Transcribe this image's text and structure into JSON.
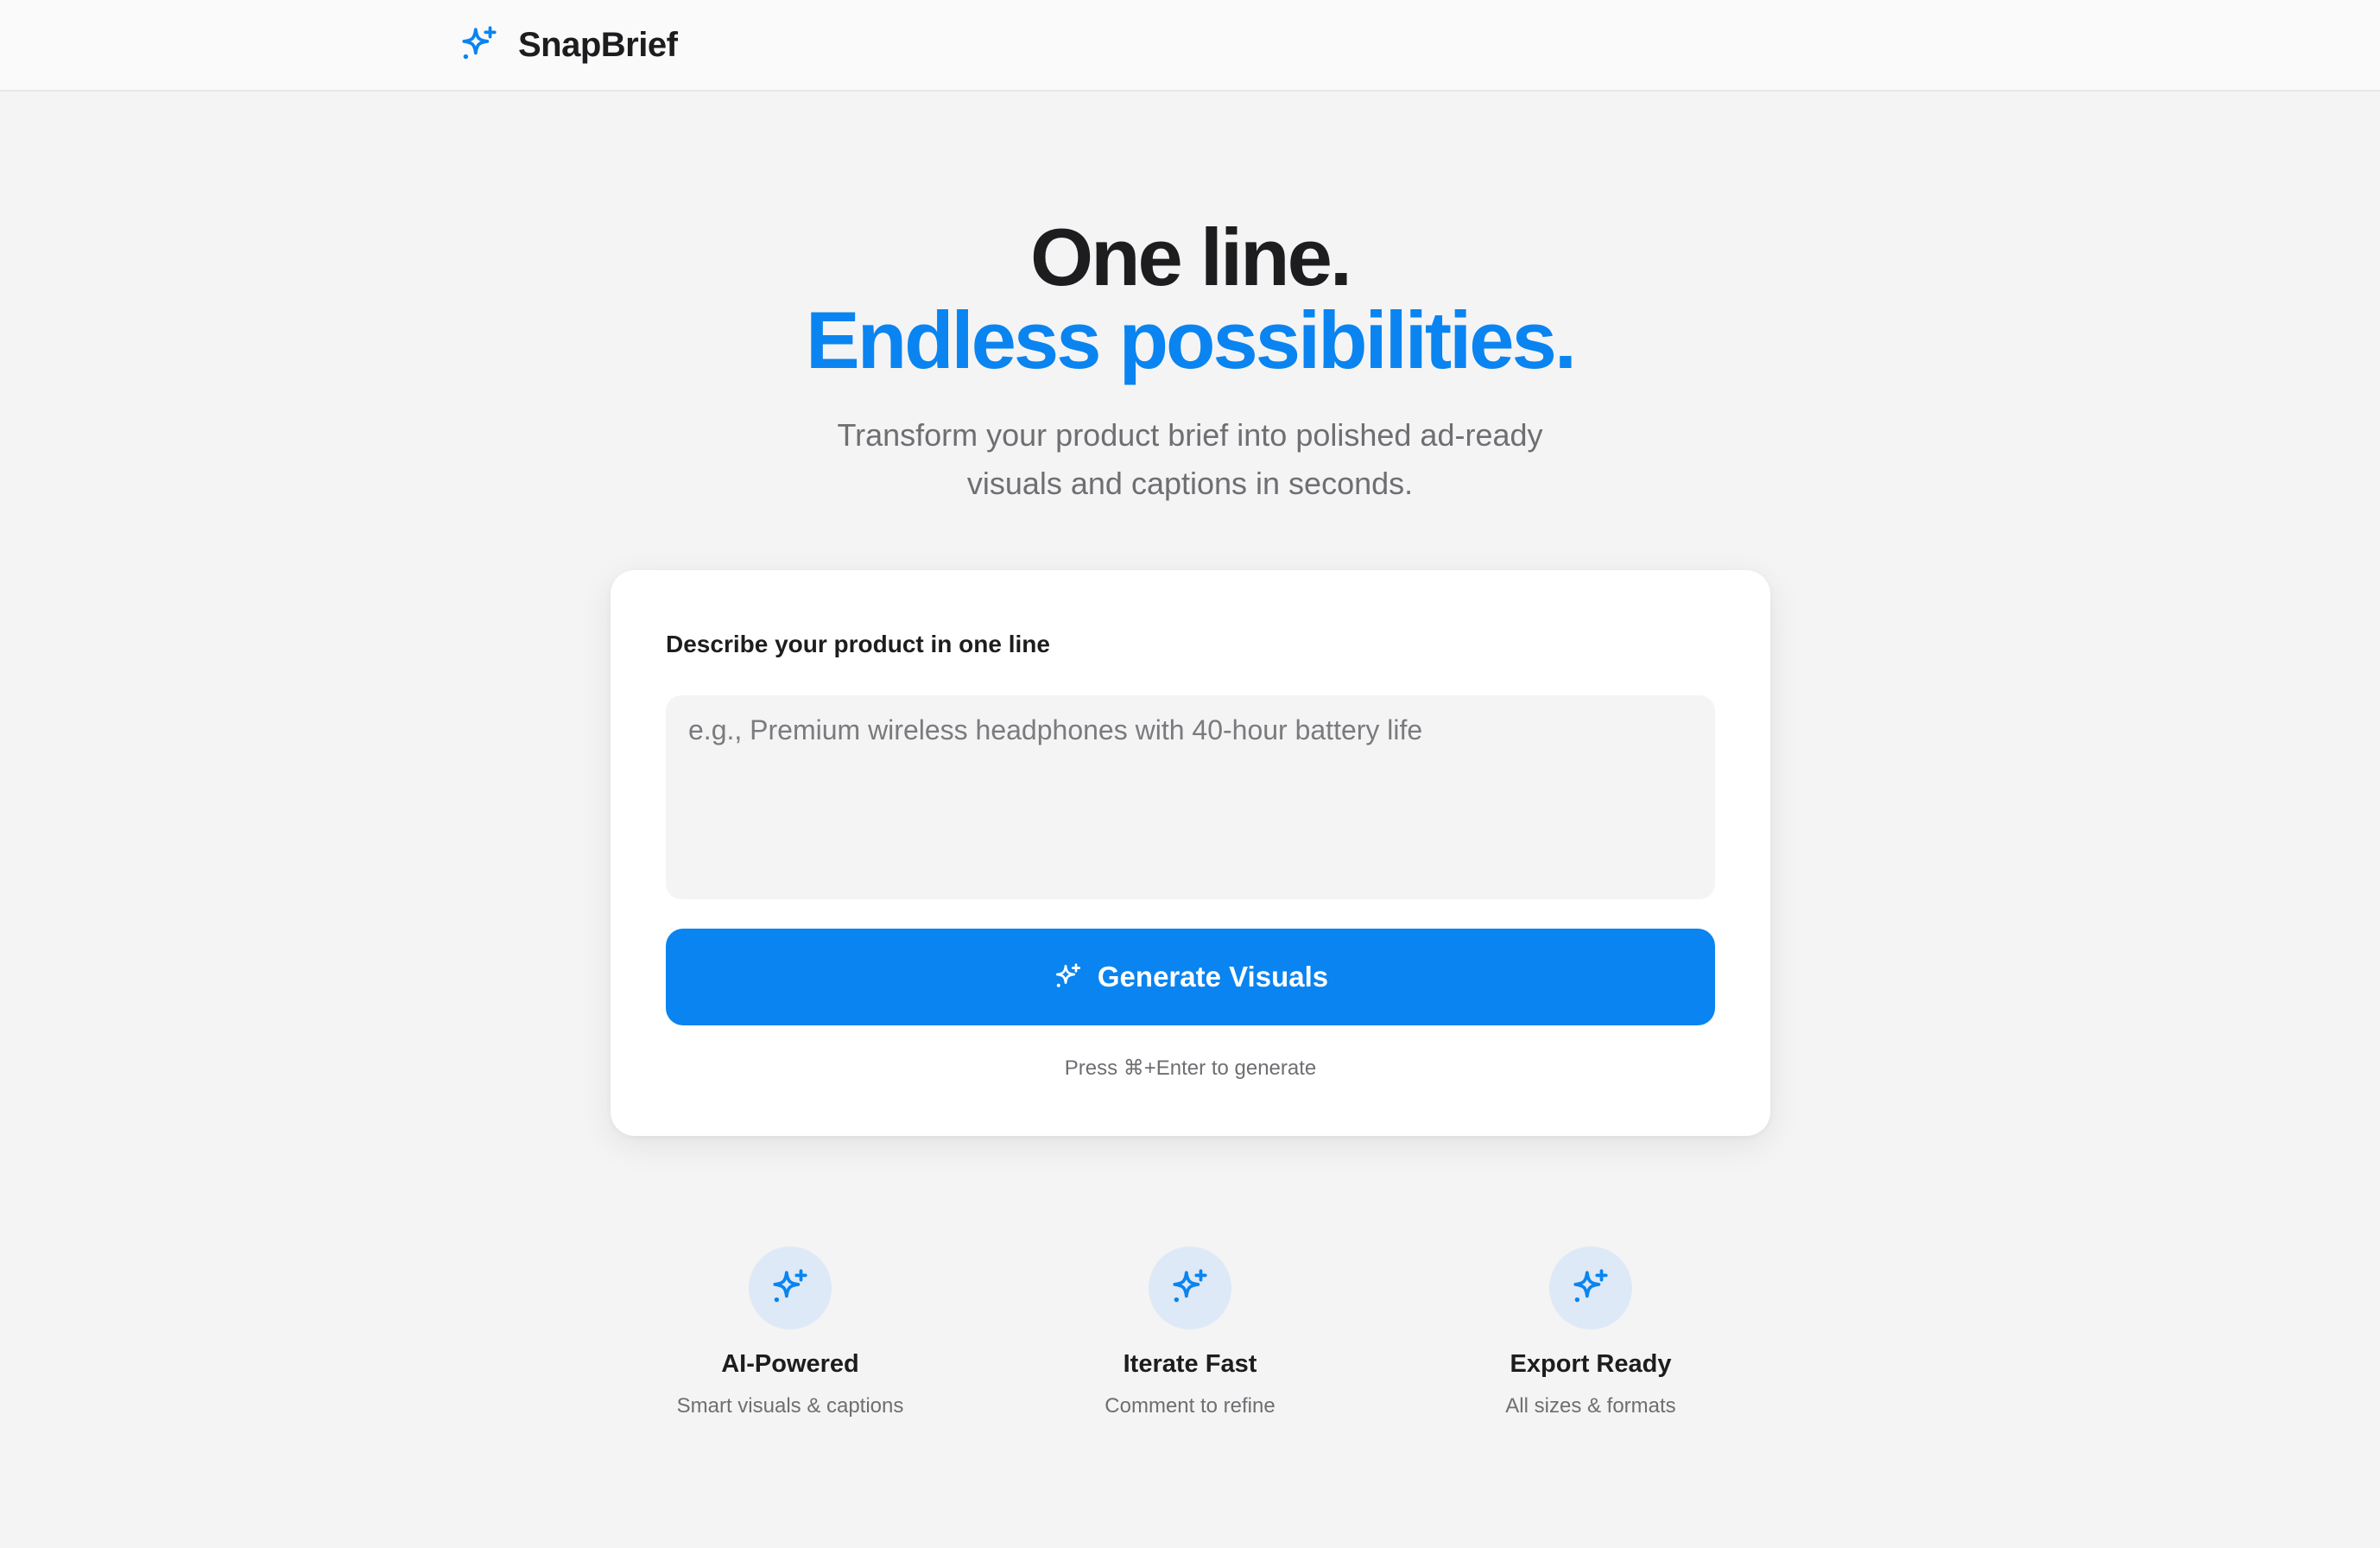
{
  "app": {
    "name": "SnapBrief",
    "logo_icon": "sparkles-icon",
    "accent_color": "#0a84f0"
  },
  "hero": {
    "headline_line1": "One line.",
    "headline_line2": "Endless possibilities.",
    "subtitle": "Transform your product brief into polished ad-ready visuals and captions in seconds."
  },
  "brief_form": {
    "label": "Describe your product in one line",
    "input_value": "",
    "placeholder": "e.g., Premium wireless headphones with 40-hour battery life",
    "generate_button_label": "Generate Visuals",
    "generate_button_icon": "sparkles-icon",
    "hint": "Press ⌘+Enter to generate"
  },
  "features": [
    {
      "icon": "sparkles-icon",
      "title": "AI-Powered",
      "description": "Smart visuals & captions"
    },
    {
      "icon": "sparkles-icon",
      "title": "Iterate Fast",
      "description": "Comment to refine"
    },
    {
      "icon": "sparkles-icon",
      "title": "Export Ready",
      "description": "All sizes & formats"
    }
  ]
}
